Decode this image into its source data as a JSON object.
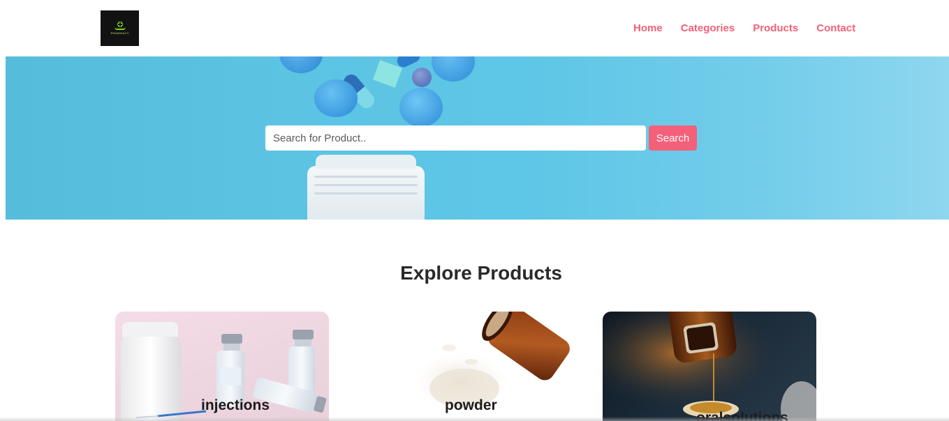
{
  "header": {
    "logo_text": "PHARMACY",
    "nav": [
      "Home",
      "Categories",
      "Products",
      "Contact"
    ]
  },
  "hero": {
    "search_placeholder": "Search for Product..",
    "search_button": "Search"
  },
  "explore": {
    "title": "Explore Products",
    "cards": [
      {
        "label": "injections"
      },
      {
        "label": "powder"
      },
      {
        "label": "oralsolutions"
      }
    ]
  },
  "colors": {
    "accent": "#f4607a",
    "hero_blue": "#5ec6e6",
    "logo_bg": "#121212",
    "logo_green": "#7bd32a"
  }
}
